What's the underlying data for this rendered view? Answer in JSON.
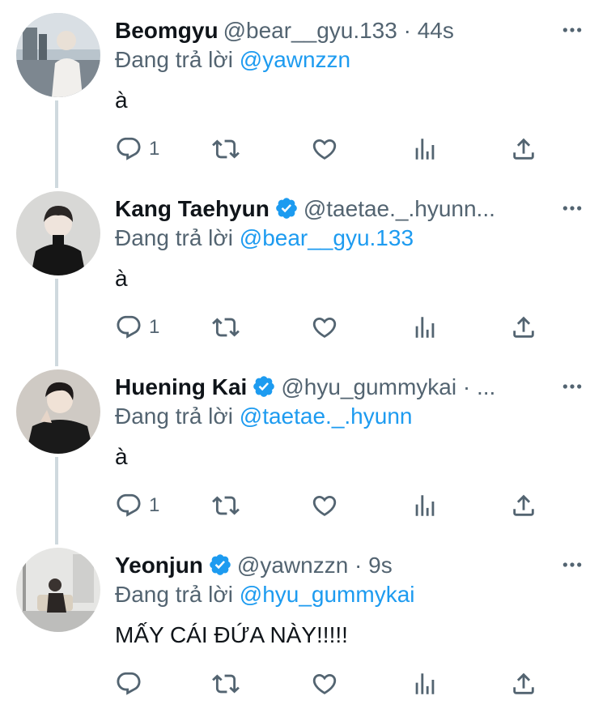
{
  "tweets": [
    {
      "name": "Beomgyu",
      "verified": false,
      "handle_meta": "@bear__gyu.133 · 44s",
      "replying_prefix": "Đang trả lời",
      "replying_to": "@yawnzzn",
      "text": "à",
      "reply_count": "1",
      "avatar_icon": "person-photo-light"
    },
    {
      "name": "Kang Taehyun",
      "verified": true,
      "handle_meta": "@taetae._.hyunn...",
      "replying_prefix": "Đang trả lời",
      "replying_to": "@bear__gyu.133",
      "text": "à",
      "reply_count": "1",
      "avatar_icon": "person-photo-dark"
    },
    {
      "name": "Huening Kai",
      "verified": true,
      "handle_meta": "@hyu_gummykai · ...",
      "replying_prefix": "Đang trả lời",
      "replying_to": "@taetae._.hyunn",
      "text": "à",
      "reply_count": "1",
      "avatar_icon": "person-photo-dark"
    },
    {
      "name": "Yeonjun",
      "verified": true,
      "handle_meta": "@yawnzzn · 9s",
      "replying_prefix": "Đang trả lời",
      "replying_to": "@hyu_gummykai",
      "text": "MẤY CÁI ĐỨA NÀY!!!!!",
      "reply_count": "",
      "avatar_icon": "person-photo-gray"
    }
  ],
  "colors": {
    "link": "#1d9bf0",
    "secondary_text": "#536471",
    "thread_line": "#cfd9de",
    "verified": "#1d9bf0"
  },
  "icons": [
    "reply-icon",
    "retweet-icon",
    "like-icon",
    "analytics-icon",
    "share-icon",
    "more-icon",
    "verified-badge-icon"
  ]
}
